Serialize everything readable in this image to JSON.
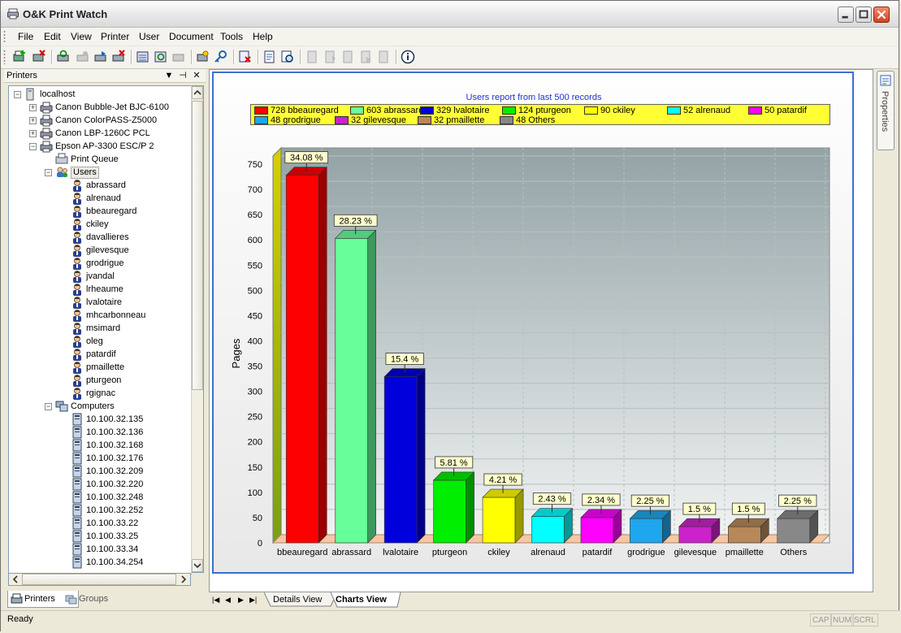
{
  "window": {
    "title": "O&K Print Watch"
  },
  "menu": [
    "File",
    "Edit",
    "View",
    "Printer",
    "User",
    "Document",
    "Tools",
    "Help"
  ],
  "toolbar_icons": [
    "add-printer-icon",
    "delete-printer-icon",
    "refresh-icon",
    "pause-icon",
    "resume-icon",
    "cancel-icon",
    "queue-icon",
    "refresh-queue-icon",
    "settings-icon",
    "properties-icon",
    "key-icon",
    "delete-job-icon",
    "report-icon",
    "preview-icon",
    "doc-first-icon",
    "doc-next-icon",
    "doc-move-icon",
    "doc-delete-icon",
    "doc-edit-icon",
    "info-icon"
  ],
  "printers_panel": {
    "title": "Printers",
    "tree": {
      "root": "localhost",
      "printers": [
        "Canon Bubble-Jet BJC-6100",
        "Canon ColorPASS-Z5000",
        "Canon LBP-1260C PCL",
        "Epson AP-3300 ESC/P 2"
      ],
      "print_queue": "Print Queue",
      "users_label": "Users",
      "users": [
        "abrassard",
        "alrenaud",
        "bbeauregard",
        "ckiley",
        "davallieres",
        "gilevesque",
        "grodrigue",
        "jvandal",
        "lrheaume",
        "lvalotaire",
        "mhcarbonneau",
        "msimard",
        "oleg",
        "patardif",
        "pmaillette",
        "pturgeon",
        "rgignac"
      ],
      "computers_label": "Computers",
      "computers": [
        "10.100.32.135",
        "10.100.32.136",
        "10.100.32.168",
        "10.100.32.176",
        "10.100.32.209",
        "10.100.32.220",
        "10.100.32.248",
        "10.100.32.252",
        "10.100.33.22",
        "10.100.33.25",
        "10.100.33.34",
        "10.100.34.254"
      ]
    },
    "tabs": [
      "Printers",
      "Groups"
    ]
  },
  "properties_tab": "Properties",
  "doc_tabs": [
    "Details View",
    "Charts View"
  ],
  "status": {
    "text": "Ready",
    "indicators": [
      "CAP",
      "NUM",
      "SCRL"
    ]
  },
  "chart_data": {
    "type": "bar",
    "title": "Users report from last 500 records",
    "ylabel": "Pages",
    "xlabel": "",
    "ylim": [
      0,
      750
    ],
    "yticks": [
      0,
      50,
      100,
      150,
      200,
      250,
      300,
      350,
      400,
      450,
      500,
      550,
      600,
      650,
      700,
      750
    ],
    "categories": [
      "bbeauregard",
      "abrassard",
      "lvalotaire",
      "pturgeon",
      "ckiley",
      "alrenaud",
      "patardif",
      "grodrigue",
      "gilevesque",
      "pmaillette",
      "Others"
    ],
    "values": [
      728,
      603,
      329,
      124,
      90,
      52,
      50,
      48,
      32,
      32,
      48
    ],
    "labels": [
      "34.08 %",
      "28.23 %",
      "15.4 %",
      "5.81 %",
      "4.21 %",
      "2.43 %",
      "2.34 %",
      "2.25 %",
      "1.5 %",
      "1.5 %",
      "2.25 %"
    ],
    "colors": [
      "#ff0000",
      "#66ff99",
      "#0000dd",
      "#00ee00",
      "#ffff00",
      "#00ffff",
      "#ff00ff",
      "#1ea7ee",
      "#cc22cc",
      "#b8885a",
      "#888888"
    ],
    "legend": [
      "728 bbeauregard",
      "603 abrassard",
      "329 lvalotaire",
      "124 pturgeon",
      "90 ckiley",
      "52 alrenaud",
      "50 patardif",
      "48 grodrigue",
      "32 gilevesque",
      "32 pmaillette",
      "48 Others"
    ],
    "legend_position": "top",
    "grid": true
  }
}
